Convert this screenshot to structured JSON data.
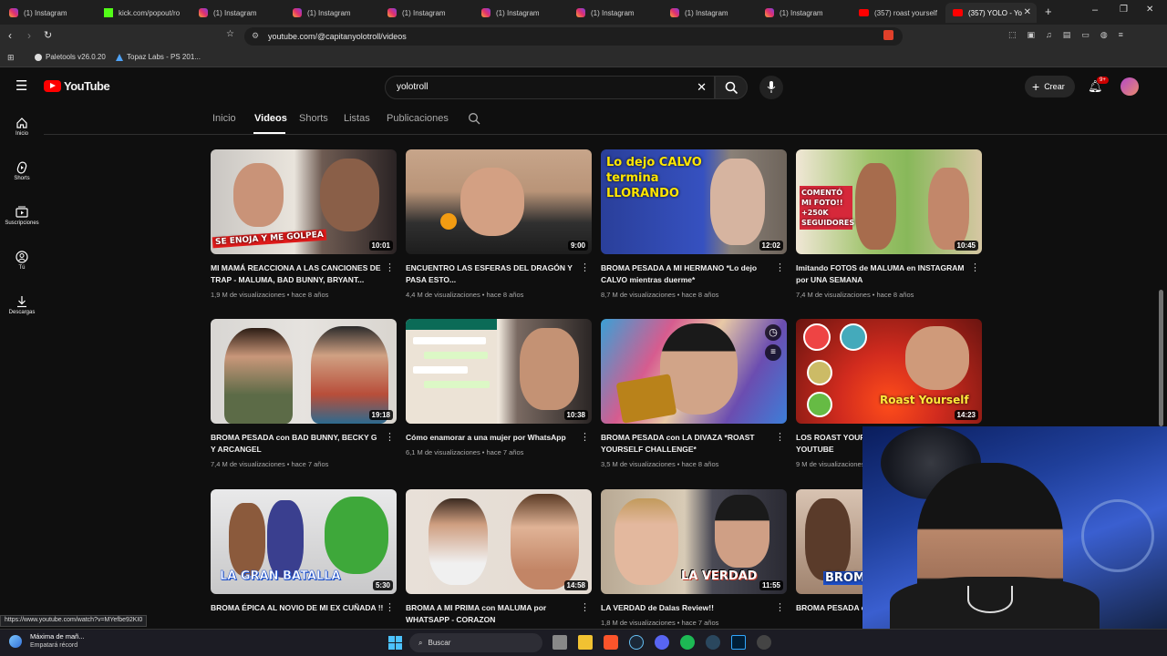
{
  "browser": {
    "tabs": [
      {
        "label": "(1) Instagram",
        "icon": "instagram-icon"
      },
      {
        "label": "kick.com/popout/ro",
        "icon": "kick-icon"
      },
      {
        "label": "(1) Instagram",
        "icon": "instagram-icon"
      },
      {
        "label": "(1) Instagram",
        "icon": "instagram-icon"
      },
      {
        "label": "(1) Instagram",
        "icon": "instagram-icon"
      },
      {
        "label": "(1) Instagram",
        "icon": "instagram-icon"
      },
      {
        "label": "(1) Instagram",
        "icon": "instagram-icon"
      },
      {
        "label": "(1) Instagram",
        "icon": "instagram-icon"
      },
      {
        "label": "(1) Instagram",
        "icon": "instagram-icon"
      },
      {
        "label": "(357) roast yourself",
        "icon": "youtube-icon"
      },
      {
        "label": "(357) YOLO - Yo",
        "icon": "youtube-icon",
        "active": true
      }
    ],
    "url": "youtube.com/@capitanyolotroll/videos",
    "bookmarks": [
      "Paletools v26.0.20",
      "Topaz Labs - PS 201..."
    ]
  },
  "youtube": {
    "logo": "YouTube",
    "search_value": "yolotroll",
    "create_label": "Crear",
    "notification_count": "9+",
    "sidebar": [
      {
        "label": "Inicio",
        "icon": "home-icon"
      },
      {
        "label": "Shorts",
        "icon": "shorts-icon"
      },
      {
        "label": "Suscripciones",
        "icon": "subscriptions-icon"
      },
      {
        "label": "Tú",
        "icon": "you-icon"
      },
      {
        "label": "Descargas",
        "icon": "downloads-icon"
      }
    ],
    "channel_tabs": [
      "Inicio",
      "Videos",
      "Shorts",
      "Listas",
      "Publicaciones"
    ],
    "videos": [
      {
        "title": "MI MAMÁ REACCIONA A LAS CANCIONES DE TRAP - MALUMA, BAD BUNNY, BRYANT...",
        "views": "1,9 M de visualizaciones",
        "age": "hace 8 años",
        "duration": "10:01",
        "overlay": "SE ENOJA Y ME GOLPEA"
      },
      {
        "title": "ENCUENTRO LAS ESFERAS DEL DRAGÓN Y PASA ESTO...",
        "views": "4,4 M de visualizaciones",
        "age": "hace 8 años",
        "duration": "9:00",
        "overlay": ""
      },
      {
        "title": "BROMA PESADA A MI HERMANO *Lo dejo CALVO mientras duerme*",
        "views": "8,7 M de visualizaciones",
        "age": "hace 8 años",
        "duration": "12:02",
        "overlay": "Lo dejo CALVO termina LLORANDO"
      },
      {
        "title": "Imitando FOTOS de MALUMA en INSTAGRAM por UNA SEMANA",
        "views": "7,4 M de visualizaciones",
        "age": "hace 8 años",
        "duration": "10:45",
        "overlay": "COMENTÓ MI FOTO!! +250K SEGUIDORES"
      },
      {
        "title": "BROMA PESADA con BAD BUNNY, BECKY G Y ARCANGEL",
        "views": "7,4 M de visualizaciones",
        "age": "hace 7 años",
        "duration": "19:18",
        "overlay": ""
      },
      {
        "title": "Cómo enamorar a una mujer por WhatsApp",
        "views": "6,1 M de visualizaciones",
        "age": "hace 7 años",
        "duration": "10:38",
        "overlay": ""
      },
      {
        "title": "BROMA PESADA con LA DIVAZA *ROAST YOURSELF CHALLENGE*",
        "views": "3,5 M de visualizaciones",
        "age": "hace 8 años",
        "duration": "",
        "overlay": ""
      },
      {
        "title": "LOS ROAST YOURSELF MÁS GRACIOSOS DE YOUTUBE",
        "views": "9 M de visualizaciones",
        "age": "",
        "duration": "14:23",
        "overlay": "Roast Yourself"
      },
      {
        "title": "BROMA ÉPICA AL NOVIO DE MI EX CUÑADA !!",
        "views": "",
        "age": "",
        "duration": "5:30",
        "overlay": "LA GRAN BATALLA"
      },
      {
        "title": "BROMA A MI PRIMA con MALUMA por WHATSAPP - CORAZON",
        "views": "",
        "age": "",
        "duration": "14:58",
        "overlay": ""
      },
      {
        "title": "LA VERDAD de Dalas Review!!",
        "views": "1,8 M de visualizaciones",
        "age": "hace 7 años",
        "duration": "11:55",
        "overlay": "LA VERDAD"
      },
      {
        "title": "BROMA PESADA con KENIA OS ft. Juan",
        "views": "",
        "age": "",
        "duration": "",
        "overlay": "BROMA"
      }
    ]
  },
  "status_url": "https://www.youtube.com/watch?v=MYefbe92KI0",
  "taskbar": {
    "weather_title": "Máxima de mañ...",
    "weather_sub": "Empatará récord",
    "search_label": "Buscar"
  }
}
